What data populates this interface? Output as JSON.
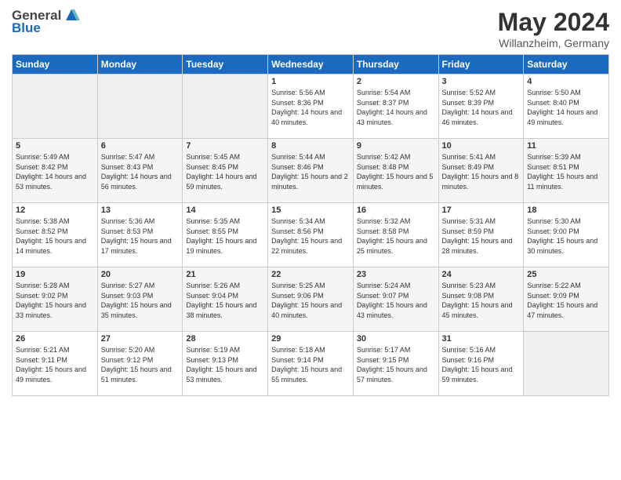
{
  "header": {
    "logo_general": "General",
    "logo_blue": "Blue",
    "month_title": "May 2024",
    "location": "Willanzheim, Germany"
  },
  "days_of_week": [
    "Sunday",
    "Monday",
    "Tuesday",
    "Wednesday",
    "Thursday",
    "Friday",
    "Saturday"
  ],
  "weeks": [
    {
      "cells": [
        {
          "day": null,
          "empty": true
        },
        {
          "day": null,
          "empty": true
        },
        {
          "day": null,
          "empty": true
        },
        {
          "day": "1",
          "sunrise": "5:56 AM",
          "sunset": "8:36 PM",
          "daylight": "14 hours and 40 minutes."
        },
        {
          "day": "2",
          "sunrise": "5:54 AM",
          "sunset": "8:37 PM",
          "daylight": "14 hours and 43 minutes."
        },
        {
          "day": "3",
          "sunrise": "5:52 AM",
          "sunset": "8:39 PM",
          "daylight": "14 hours and 46 minutes."
        },
        {
          "day": "4",
          "sunrise": "5:50 AM",
          "sunset": "8:40 PM",
          "daylight": "14 hours and 49 minutes."
        }
      ]
    },
    {
      "cells": [
        {
          "day": "5",
          "sunrise": "5:49 AM",
          "sunset": "8:42 PM",
          "daylight": "14 hours and 53 minutes."
        },
        {
          "day": "6",
          "sunrise": "5:47 AM",
          "sunset": "8:43 PM",
          "daylight": "14 hours and 56 minutes."
        },
        {
          "day": "7",
          "sunrise": "5:45 AM",
          "sunset": "8:45 PM",
          "daylight": "14 hours and 59 minutes."
        },
        {
          "day": "8",
          "sunrise": "5:44 AM",
          "sunset": "8:46 PM",
          "daylight": "15 hours and 2 minutes."
        },
        {
          "day": "9",
          "sunrise": "5:42 AM",
          "sunset": "8:48 PM",
          "daylight": "15 hours and 5 minutes."
        },
        {
          "day": "10",
          "sunrise": "5:41 AM",
          "sunset": "8:49 PM",
          "daylight": "15 hours and 8 minutes."
        },
        {
          "day": "11",
          "sunrise": "5:39 AM",
          "sunset": "8:51 PM",
          "daylight": "15 hours and 11 minutes."
        }
      ]
    },
    {
      "cells": [
        {
          "day": "12",
          "sunrise": "5:38 AM",
          "sunset": "8:52 PM",
          "daylight": "15 hours and 14 minutes."
        },
        {
          "day": "13",
          "sunrise": "5:36 AM",
          "sunset": "8:53 PM",
          "daylight": "15 hours and 17 minutes."
        },
        {
          "day": "14",
          "sunrise": "5:35 AM",
          "sunset": "8:55 PM",
          "daylight": "15 hours and 19 minutes."
        },
        {
          "day": "15",
          "sunrise": "5:34 AM",
          "sunset": "8:56 PM",
          "daylight": "15 hours and 22 minutes."
        },
        {
          "day": "16",
          "sunrise": "5:32 AM",
          "sunset": "8:58 PM",
          "daylight": "15 hours and 25 minutes."
        },
        {
          "day": "17",
          "sunrise": "5:31 AM",
          "sunset": "8:59 PM",
          "daylight": "15 hours and 28 minutes."
        },
        {
          "day": "18",
          "sunrise": "5:30 AM",
          "sunset": "9:00 PM",
          "daylight": "15 hours and 30 minutes."
        }
      ]
    },
    {
      "cells": [
        {
          "day": "19",
          "sunrise": "5:28 AM",
          "sunset": "9:02 PM",
          "daylight": "15 hours and 33 minutes."
        },
        {
          "day": "20",
          "sunrise": "5:27 AM",
          "sunset": "9:03 PM",
          "daylight": "15 hours and 35 minutes."
        },
        {
          "day": "21",
          "sunrise": "5:26 AM",
          "sunset": "9:04 PM",
          "daylight": "15 hours and 38 minutes."
        },
        {
          "day": "22",
          "sunrise": "5:25 AM",
          "sunset": "9:06 PM",
          "daylight": "15 hours and 40 minutes."
        },
        {
          "day": "23",
          "sunrise": "5:24 AM",
          "sunset": "9:07 PM",
          "daylight": "15 hours and 43 minutes."
        },
        {
          "day": "24",
          "sunrise": "5:23 AM",
          "sunset": "9:08 PM",
          "daylight": "15 hours and 45 minutes."
        },
        {
          "day": "25",
          "sunrise": "5:22 AM",
          "sunset": "9:09 PM",
          "daylight": "15 hours and 47 minutes."
        }
      ]
    },
    {
      "cells": [
        {
          "day": "26",
          "sunrise": "5:21 AM",
          "sunset": "9:11 PM",
          "daylight": "15 hours and 49 minutes."
        },
        {
          "day": "27",
          "sunrise": "5:20 AM",
          "sunset": "9:12 PM",
          "daylight": "15 hours and 51 minutes."
        },
        {
          "day": "28",
          "sunrise": "5:19 AM",
          "sunset": "9:13 PM",
          "daylight": "15 hours and 53 minutes."
        },
        {
          "day": "29",
          "sunrise": "5:18 AM",
          "sunset": "9:14 PM",
          "daylight": "15 hours and 55 minutes."
        },
        {
          "day": "30",
          "sunrise": "5:17 AM",
          "sunset": "9:15 PM",
          "daylight": "15 hours and 57 minutes."
        },
        {
          "day": "31",
          "sunrise": "5:16 AM",
          "sunset": "9:16 PM",
          "daylight": "15 hours and 59 minutes."
        },
        {
          "day": null,
          "empty": true
        }
      ]
    }
  ]
}
